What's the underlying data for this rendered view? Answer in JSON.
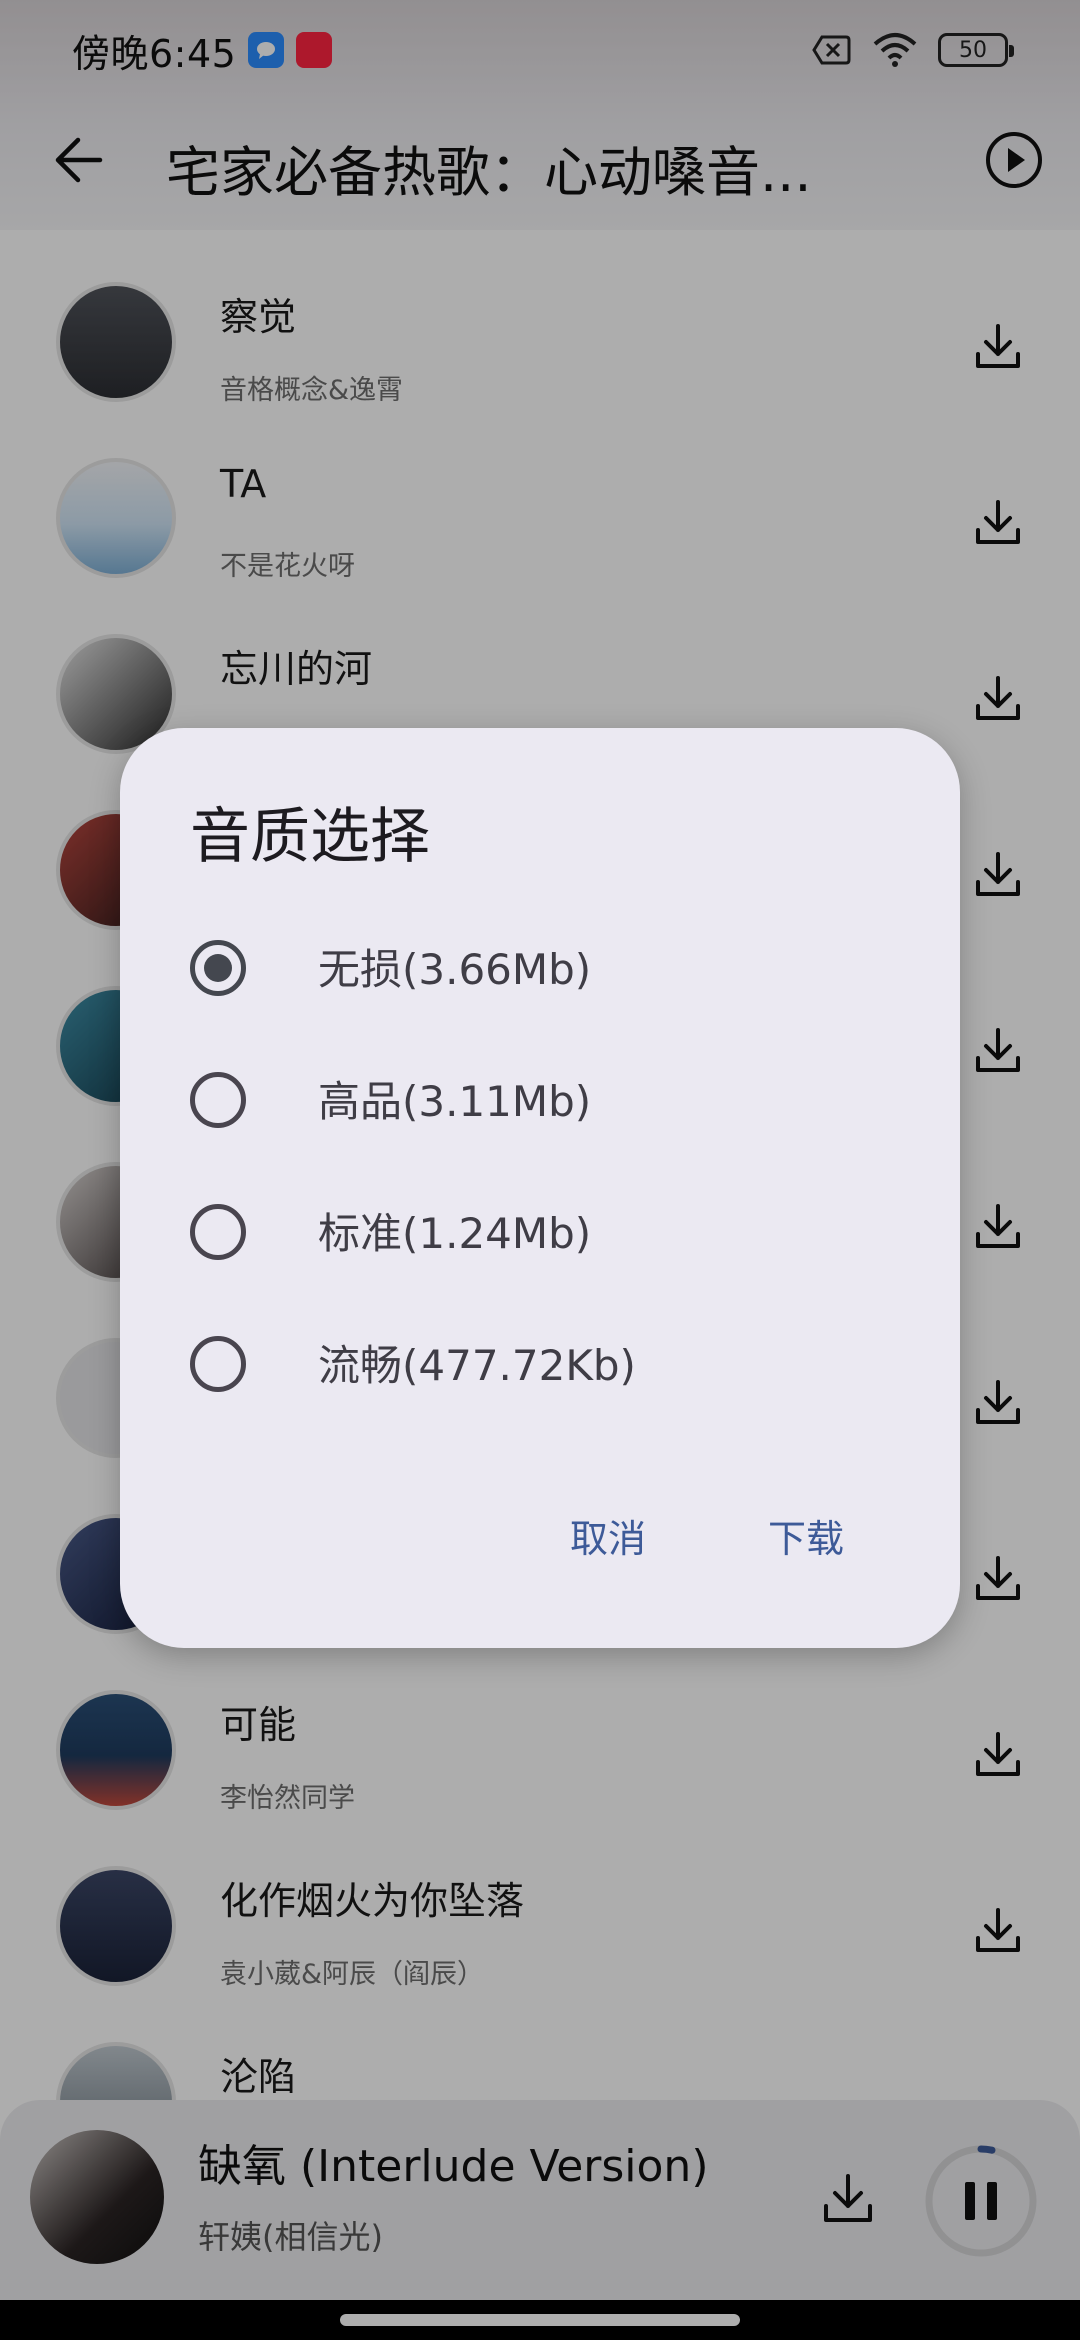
{
  "status_bar": {
    "time": "傍晚6:45",
    "app_badge_red": "小红书",
    "battery": "50"
  },
  "header": {
    "title": "宅家必备热歌：心动嗓音..."
  },
  "songs": [
    {
      "title": "察觉",
      "artist": "音格概念&逸霄"
    },
    {
      "title": "TA",
      "artist": "不是花火呀"
    },
    {
      "title": "忘川的河",
      "artist": ""
    },
    {
      "title": "",
      "artist": ""
    },
    {
      "title": "",
      "artist": ""
    },
    {
      "title": "",
      "artist": ""
    },
    {
      "title": "",
      "artist": ""
    },
    {
      "title": "",
      "artist": ""
    },
    {
      "title": "可能",
      "artist": "李怡然同学"
    },
    {
      "title": "化作烟火为你坠落",
      "artist": "袁小葳&阿辰（阎辰）"
    },
    {
      "title": "沦陷",
      "artist": ""
    }
  ],
  "dialog": {
    "title": "音质选择",
    "options": [
      {
        "label": "无损(3.66Mb)",
        "selected": true
      },
      {
        "label": "高品(3.11Mb)",
        "selected": false
      },
      {
        "label": "标准(1.24Mb)",
        "selected": false
      },
      {
        "label": "流畅(477.72Kb)",
        "selected": false
      }
    ],
    "cancel_label": "取消",
    "download_label": "下载"
  },
  "player": {
    "title": "缺氧 (Interlude Version)",
    "artist": "轩姨(相信光)"
  },
  "colors": {
    "accent": "#3d5a98",
    "dialog_bg": "#ebe9f2",
    "scrim": "rgba(0,0,0,0.32)"
  }
}
